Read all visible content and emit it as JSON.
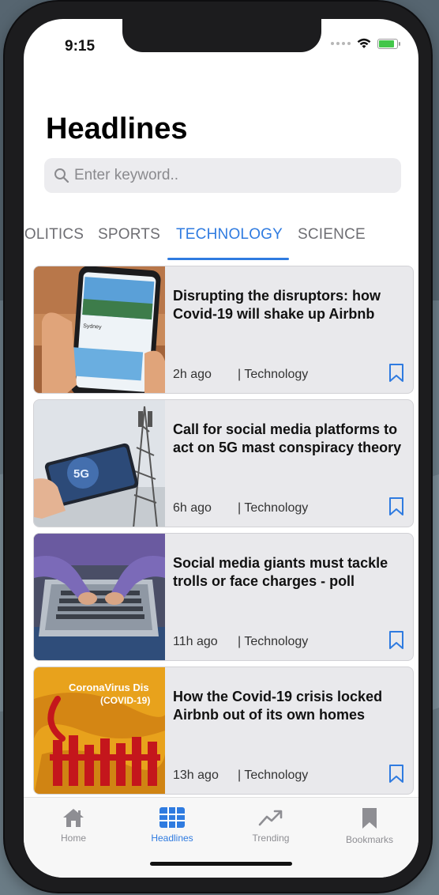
{
  "status_bar": {
    "time": "9:15"
  },
  "header": {
    "title": "Headlines"
  },
  "search": {
    "placeholder": "Enter keyword.."
  },
  "tabs": [
    {
      "label": "POLITICS"
    },
    {
      "label": "SPORTS"
    },
    {
      "label": "TECHNOLOGY",
      "active": true
    },
    {
      "label": "SCIENCE"
    }
  ],
  "articles": [
    {
      "title": "Disrupting the disruptors: how Covid-19 will shake up Airbnb",
      "time": "2h ago",
      "category": "| Technology"
    },
    {
      "title": "Call for social media platforms  to act on 5G mast conspiracy theory",
      "time": "6h ago",
      "category": "| Technology"
    },
    {
      "title": "Social media giants must tackle trolls or face charges - poll",
      "time": "11h ago",
      "category": "| Technology"
    },
    {
      "title": "How the Covid-19 crisis locked Airbnb out of its own homes",
      "time": "13h ago",
      "category": "| Technology"
    }
  ],
  "thumb_text": {
    "phone_city": "Sydney",
    "badge_5g": "5G",
    "corona_line1": "CoronaVirus Dis",
    "corona_line2": "(COVID-19)"
  },
  "tabbar": [
    {
      "label": "Home",
      "icon": "home-icon"
    },
    {
      "label": "Headlines",
      "icon": "grid-icon",
      "active": true
    },
    {
      "label": "Trending",
      "icon": "trending-icon"
    },
    {
      "label": "Bookmarks",
      "icon": "bookmark-icon"
    }
  ],
  "colors": {
    "accent": "#2f7be0",
    "card_bg": "#e9e9ec",
    "battery": "#43c64a"
  },
  "battery_level": 0.85
}
